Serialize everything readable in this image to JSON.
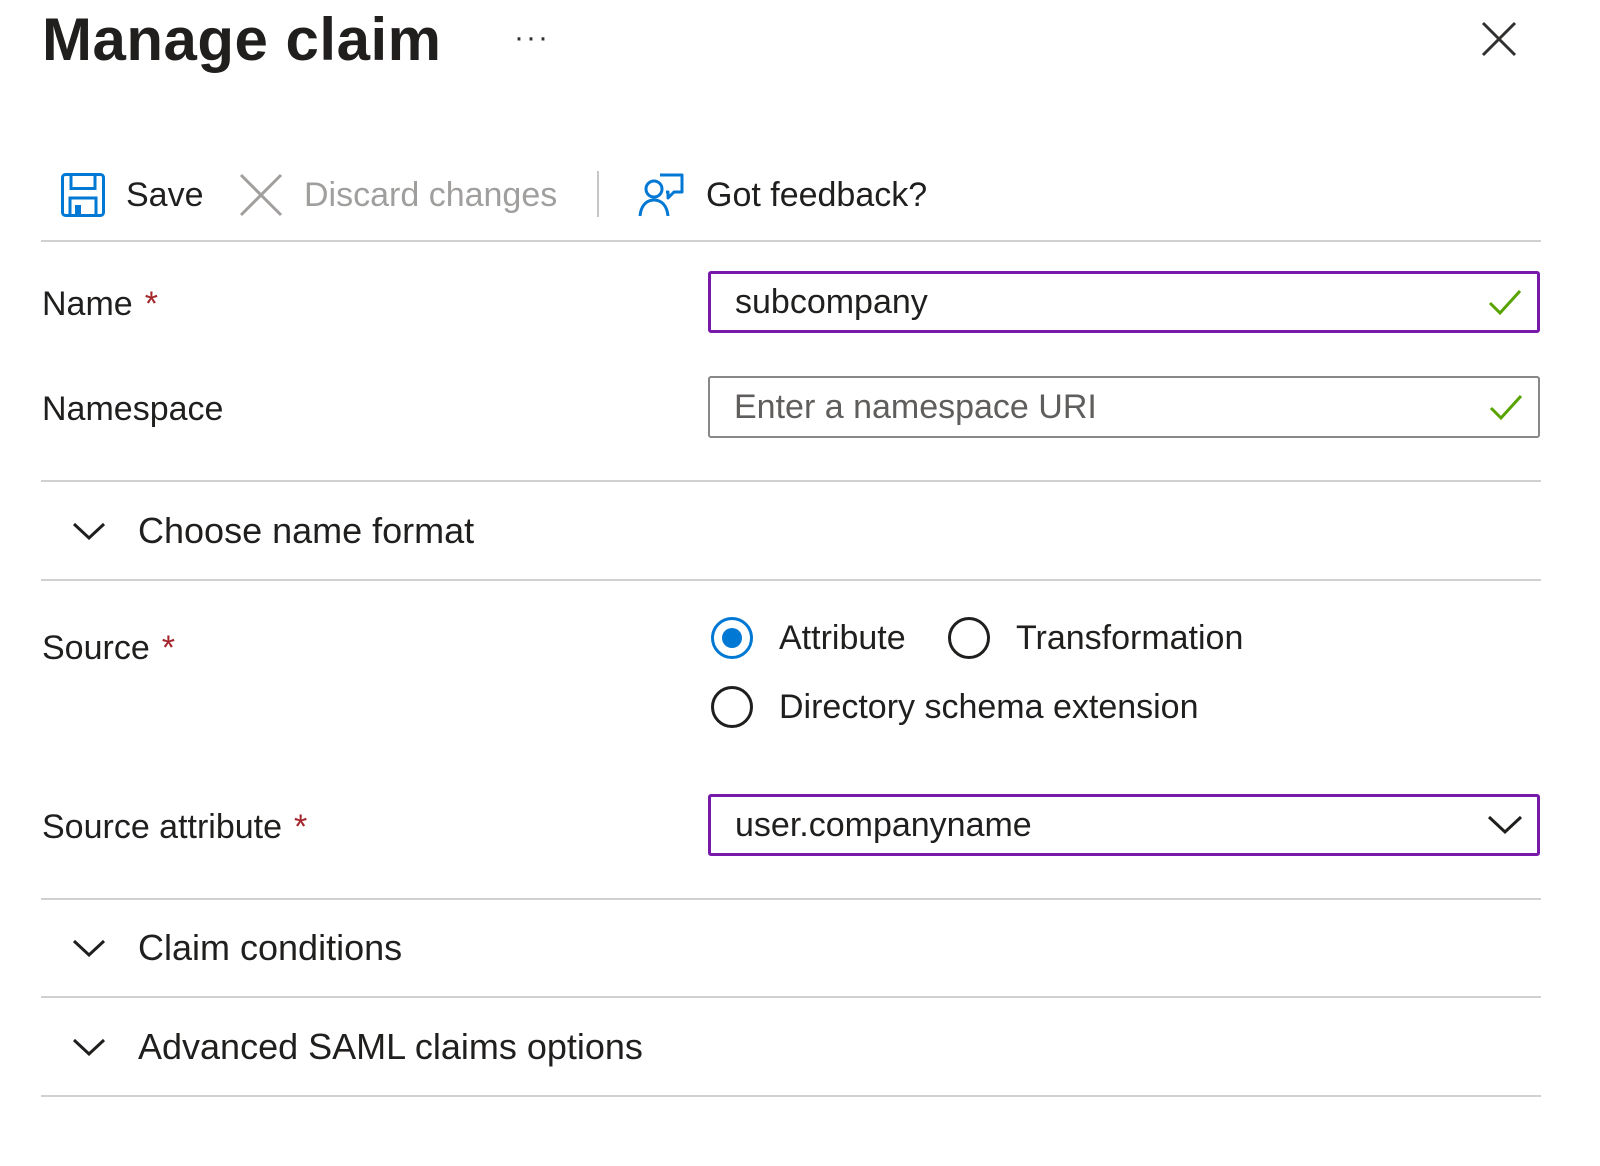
{
  "panel": {
    "title": "Manage claim",
    "more_label": "···"
  },
  "toolbar": {
    "save_label": "Save",
    "discard_label": "Discard changes",
    "feedback_label": "Got feedback?"
  },
  "form": {
    "required_marker": "*",
    "name": {
      "label": "Name",
      "value": "subcompany",
      "required": true,
      "valid": true
    },
    "namespace": {
      "label": "Namespace",
      "placeholder": "Enter a namespace URI",
      "value": "",
      "valid": true
    },
    "name_format": {
      "label": "Choose name format",
      "expanded": false
    },
    "source": {
      "label": "Source",
      "required": true,
      "options": [
        {
          "label": "Attribute",
          "selected": true
        },
        {
          "label": "Transformation",
          "selected": false
        },
        {
          "label": "Directory schema extension",
          "selected": false
        }
      ]
    },
    "source_attribute": {
      "label": "Source attribute",
      "required": true,
      "value": "user.companyname"
    },
    "claim_conditions": {
      "label": "Claim conditions",
      "expanded": false
    },
    "advanced": {
      "label": "Advanced SAML claims options",
      "expanded": false
    }
  },
  "colors": {
    "focus_border": "#7719aa",
    "radio_selected": "#0078d4",
    "valid_check": "#57a300",
    "required_asterisk": "#a4262c",
    "icon_blue": "#0078d4",
    "disabled_text": "#a19f9d"
  },
  "icons": {
    "close": "close-icon",
    "save": "save-icon",
    "discard": "discard-icon",
    "feedback": "feedback-icon",
    "check": "check-icon",
    "chevron": "chevron-down-icon"
  }
}
